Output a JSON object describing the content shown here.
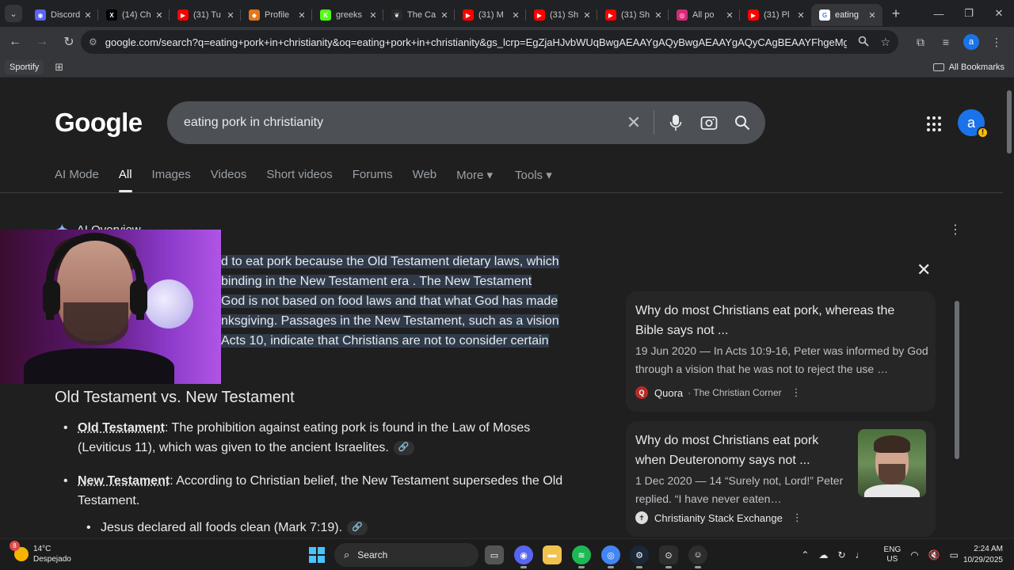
{
  "browser": {
    "tabs": [
      {
        "label": "Discord",
        "icon": "discord-icon",
        "color": "#5865f2",
        "glyph": "◉"
      },
      {
        "label": "(14) Ch",
        "icon": "x-icon",
        "color": "#000000",
        "glyph": "X"
      },
      {
        "label": "(31) Tu",
        "icon": "youtube-icon",
        "color": "#ff0000",
        "glyph": "▶"
      },
      {
        "label": "Profile",
        "icon": "metamask-icon",
        "color": "#e2761b",
        "glyph": "◆"
      },
      {
        "label": "greeks",
        "icon": "kick-icon",
        "color": "#53fc18",
        "glyph": "K"
      },
      {
        "label": "The Ca",
        "icon": "leaf-icon",
        "color": "#2a2a2a",
        "glyph": "❦"
      },
      {
        "label": "(31) M",
        "icon": "youtube-icon",
        "color": "#ff0000",
        "glyph": "▶"
      },
      {
        "label": "(31) Sh",
        "icon": "youtube-icon",
        "color": "#ff0000",
        "glyph": "▶"
      },
      {
        "label": "(31) Sh",
        "icon": "youtube-icon",
        "color": "#ff0000",
        "glyph": "▶"
      },
      {
        "label": "All po",
        "icon": "instagram-icon",
        "color": "#d62976",
        "glyph": "◎"
      },
      {
        "label": "(31) Pl",
        "icon": "youtube-icon",
        "color": "#ff0000",
        "glyph": "▶"
      },
      {
        "label": "eating",
        "icon": "google-icon",
        "color": "#ffffff",
        "glyph": "G",
        "active": true
      }
    ],
    "url": "google.com/search?q=eating+pork+in+christianity&oq=eating+pork+in+christianity&gs_lcrp=EgZjaHJvbWUqBwgAEAAYgAQyBwgAEAAYgAQyCAgBEAAYFhgeMggIAhAAGBYYHjIIC...",
    "bookmarks": {
      "first": "Sportify",
      "all": "All Bookmarks"
    },
    "profile_initial": "a"
  },
  "search": {
    "logo": "Google",
    "query": "eating pork in christianity",
    "tabs": [
      "AI Mode",
      "All",
      "Images",
      "Videos",
      "Short videos",
      "Forums",
      "Web",
      "More ▾",
      "Tools ▾"
    ],
    "selected_tab": "All",
    "avatar_initial": "a"
  },
  "ai_overview": {
    "heading": "AI Overview",
    "lines": [
      "d to eat pork because the Old Testament dietary laws, which",
      "binding in the New Testament era . The New Testament",
      "God is not based on food laws and that what God has made",
      "nksgiving. Passages in the New Testament, such as a vision",
      "Acts 10, indicate that Christians are not to consider certain"
    ],
    "section_title": "Old Testament vs. New Testament",
    "bullets": [
      {
        "term": "Old Testament",
        "text": ": The prohibition against eating pork is found in the Law of Moses (Leviticus 11), which was given to the ancient Israelites."
      },
      {
        "term": "New Testament",
        "text": ": According to Christian belief, the New Testament supersedes the Old Testament."
      }
    ],
    "sub_bullet": "Jesus declared all foods clean (Mark 7:19)."
  },
  "sources": [
    {
      "title": "Why do most Christians eat pork, whereas the Bible says not ...",
      "snippet": "19 Jun 2020 — In Acts 10:9-16, Peter was informed by God through a vision that he was not to reject the use …",
      "source": "Quora",
      "sub": "· The Christian Corner",
      "icon_color": "#b92b27",
      "icon_glyph": "Q"
    },
    {
      "title": "Why do most Christians eat pork when Deuteronomy says not ...",
      "snippet": "1 Dec 2020 — 14 “Surely not, Lord!” Peter replied. “I have never eaten…",
      "source": "Christianity Stack Exchange",
      "sub": "",
      "icon_color": "#dddddd",
      "icon_glyph": "✝"
    }
  ],
  "taskbar": {
    "weather_temp": "14°C",
    "weather_desc": "Despejado",
    "weather_badge": "8",
    "search_label": "Search",
    "lang_top": "ENG",
    "lang_bottom": "US",
    "time": "2:24 AM",
    "date": "10/29/2025"
  }
}
